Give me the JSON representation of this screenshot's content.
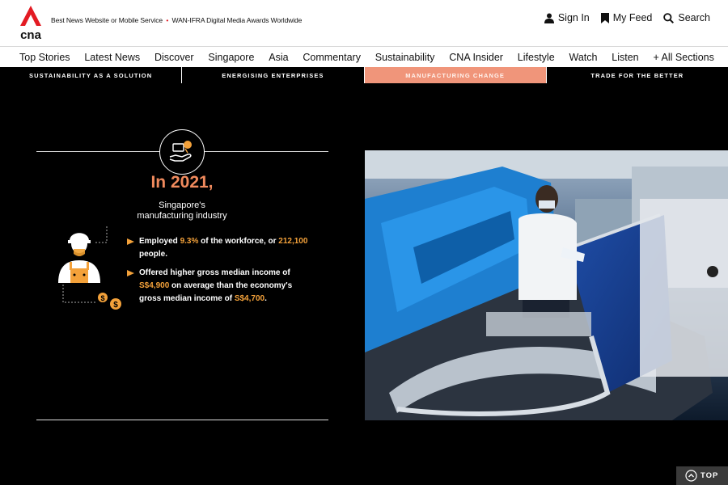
{
  "header": {
    "logo_text": "cna",
    "tagline_part1": "Best News Website or Mobile Service",
    "tagline_sep": "•",
    "tagline_part2": "WAN-IFRA Digital Media Awards Worldwide",
    "sign_in": "Sign In",
    "my_feed": "My Feed",
    "search": "Search"
  },
  "nav": [
    "Top Stories",
    "Latest News",
    "Discover",
    "Singapore",
    "Asia",
    "Commentary",
    "Sustainability",
    "CNA Insider",
    "Lifestyle",
    "Watch",
    "Listen",
    "+ All Sections"
  ],
  "subtabs": [
    "SUSTAINABILITY AS A SOLUTION",
    "ENERGISING ENTERPRISES",
    "MANUFACTURING CHANGE",
    "TRADE FOR THE BETTER"
  ],
  "subtab_active": 2,
  "infographic": {
    "year": "In 2021,",
    "subtitle_line1": "Singapore's",
    "subtitle_line2": "manufacturing industry",
    "b1_a": "Employed ",
    "b1_h1": "9.3%",
    "b1_b": " of the workforce, or ",
    "b1_h2": "212,100",
    "b1_c": " people.",
    "b2_a": "Offered higher gross median income of ",
    "b2_h1": "S$4,900",
    "b2_b": " on average than the economy's gross median income of ",
    "b2_h2": "S$4,700",
    "b2_c": "."
  },
  "top_button": "TOP",
  "colors": {
    "accent": "#f08a5d",
    "highlight": "#f3a13a",
    "brand_red": "#e31b23"
  }
}
